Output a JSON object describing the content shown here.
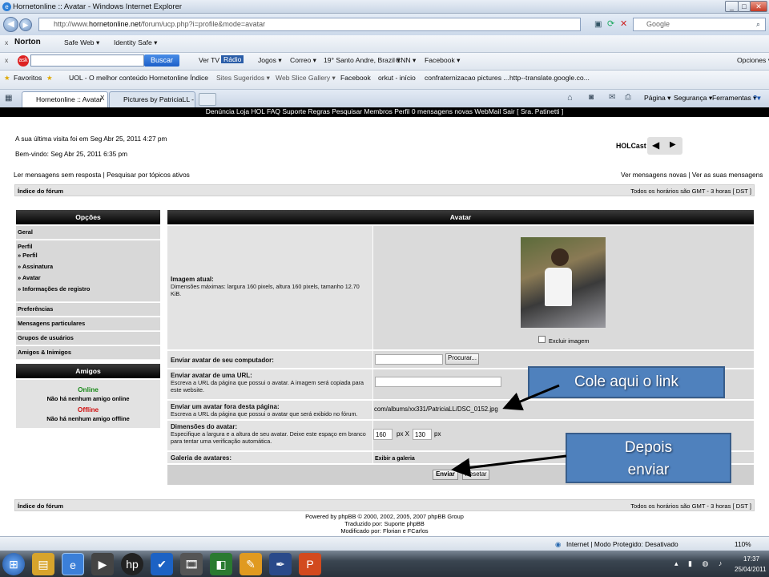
{
  "window": {
    "title": "Hornetonline :: Avatar - Windows Internet Explorer"
  },
  "address": {
    "url_prefix": "http://www.",
    "url_domain": "hornetonline.net",
    "url_path": "/forum/ucp.php?i=profile&mode=avatar",
    "search_placeholder": "Google"
  },
  "norton_bar": {
    "brand": "Norton",
    "safe_web": "Safe Web ▾",
    "identity_safe": "Identity Safe ▾"
  },
  "ask_bar": {
    "search_button": "Buscar",
    "items": [
      "Ver TV",
      "Rádio",
      "Jogos ▾",
      "Correo ▾",
      "19° Santo Andre, Brazil ▾",
      "CNN ▾",
      "Facebook ▾"
    ],
    "options": "Opciones ▾"
  },
  "favorites_bar": {
    "label": "Favoritos",
    "items": [
      "UOL - O melhor conteúdo",
      "Hornetonline Índice",
      "Sites Sugeridos ▾",
      "Web Slice Gallery ▾",
      "Facebook",
      "orkut - início",
      "confraternizacao pictures ...",
      "http--translate.google.co..."
    ]
  },
  "tabs": [
    {
      "label": "Hornetonline :: Avatar",
      "active": true
    },
    {
      "label": "Pictures by PatriciaLL - Ph...",
      "active": false
    }
  ],
  "command_bar": {
    "page": "Página ▾",
    "safety": "Segurança ▾",
    "tools": "Ferramentas ▾",
    "help": "?▾"
  },
  "forum": {
    "top_nav": "Denúncia  Loja HOL  FAQ  Suporte  Regras  Pesquisar Membros  Perfil  0 mensagens novas  WebMail  Sair [ Sra. Patinetti ]",
    "last_visit": "A sua última visita foi em Seg Abr 25, 2011 4:27 pm",
    "welcome": "Bem-vindo: Seg Abr 25, 2011 6:35 pm",
    "holcast": "HOLCast",
    "unanswered": "Ler mensagens sem resposta | Pesquisar por tópicos ativos",
    "new_posts": "Ver mensagens novas | Ver as suas mensagens",
    "forum_index": "Índice do fórum",
    "timezone": "Todos os horários são GMT - 3 horas [ DST ]",
    "options": {
      "heading": "Opções",
      "general": "Geral",
      "profile": "Perfil",
      "profile_items": [
        "» Perfil",
        "» Assinatura",
        "» Avatar",
        "» Informações de registro"
      ],
      "others": [
        "Preferências",
        "Mensagens particulares",
        "Grupos de usuários",
        "Amigos & Inimigos"
      ]
    },
    "friends": {
      "heading": "Amigos",
      "online": "Online",
      "online_none": "Não há nenhum amigo online",
      "offline": "Offline",
      "offline_none": "Não há nenhum amigo offline"
    },
    "avatar": {
      "heading": "Avatar",
      "current_label": "Imagem atual:",
      "current_desc": "Dimensões máximas: largura 160 pixels, altura 160 pixels, tamanho 12.70 KiB.",
      "delete_image": "Excluir imagem",
      "upload_label": "Enviar avatar de seu computador:",
      "browse": "Procurar...",
      "url_label": "Enviar avatar de uma URL:",
      "url_desc": "Escreva a URL da página que possui o avatar. A imagem será copiada para este website.",
      "remote_label": "Enviar um avatar fora desta página:",
      "remote_desc": "Escreva a URL da página que possui o avatar que será exibido no fórum.",
      "remote_value": "com/albums/xx331/PatriciaLL/DSC_0152.jpg",
      "dims_label": "Dimensões do avatar:",
      "dims_desc": "Especifique a largura e a altura de seu avatar. Deixe este espaço em branco para tentar uma verificação automática.",
      "width": "160",
      "px1": "px X",
      "height": "130",
      "px2": "px",
      "gallery_label": "Galeria de avatares:",
      "gallery_link": "Exibir a galeria",
      "submit": "Enviar",
      "reset": "Resetar"
    },
    "footer": {
      "powered": "Powered by phpBB © 2000, 2002, 2005, 2007 phpBB Group",
      "translated": "Traduzido por: Suporte phpBB",
      "modified": "Modificado por: Florian e FCarlos"
    }
  },
  "callouts": {
    "paste_link": "Cole aqui o link",
    "then_send": "Depois enviar"
  },
  "status_bar": {
    "zone": "Internet | Modo Protegido: Desativado",
    "zoom": "110%"
  },
  "taskbar": {
    "time": "17:37",
    "date": "25/04/2011"
  }
}
